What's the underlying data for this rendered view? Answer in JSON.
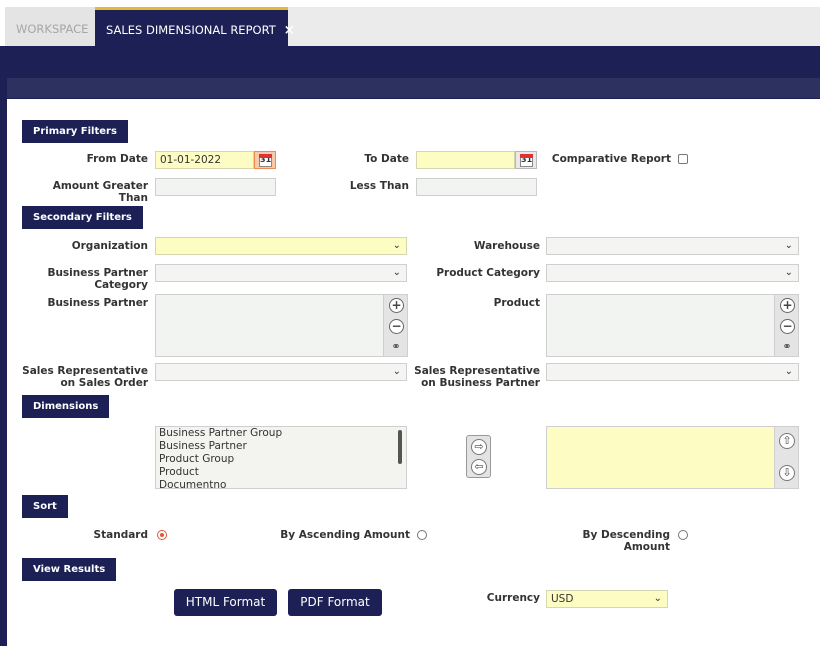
{
  "tabs": {
    "workspace": "WORKSPACE",
    "active": "SALES DIMENSIONAL REPORT",
    "close": "×"
  },
  "sections": {
    "primary": "Primary Filters",
    "secondary": "Secondary Filters",
    "dimensions": "Dimensions",
    "sort": "Sort",
    "view": "View Results"
  },
  "primary": {
    "from_date_label": "From Date",
    "from_date_value": "01-01-2022",
    "to_date_label": "To Date",
    "to_date_value": "",
    "comparative_label": "Comparative Report",
    "amount_greater_label": "Amount Greater Than",
    "less_than_label": "Less Than",
    "calendar_glyph": "31"
  },
  "secondary": {
    "organization_label": "Organization",
    "warehouse_label": "Warehouse",
    "bp_category_label_1": "Business Partner",
    "bp_category_label_2": "Category",
    "product_category_label": "Product Category",
    "business_partner_label": "Business Partner",
    "product_label": "Product",
    "sales_rep_order_label_1": "Sales Representative",
    "sales_rep_order_label_2": "on Sales Order",
    "sales_rep_bp_label_1": "Sales Representative",
    "sales_rep_bp_label_2": "on Business Partner"
  },
  "dimensions": {
    "available": [
      "Business Partner Group",
      "Business Partner",
      "Product Group",
      "Product",
      "Documentno"
    ]
  },
  "sort": {
    "standard_label": "Standard",
    "ascending_label": "By Ascending Amount",
    "descending_label_1": "By Descending",
    "descending_label_2": "Amount",
    "selected": "Standard"
  },
  "view": {
    "html_button": "HTML Format",
    "pdf_button": "PDF Format",
    "currency_label": "Currency",
    "currency_value": "USD"
  },
  "colors": {
    "navy": "#1c2054",
    "required_yellow": "#fdfcc3",
    "tab_accent": "#e7b92f",
    "radio_on": "#e0583a"
  }
}
